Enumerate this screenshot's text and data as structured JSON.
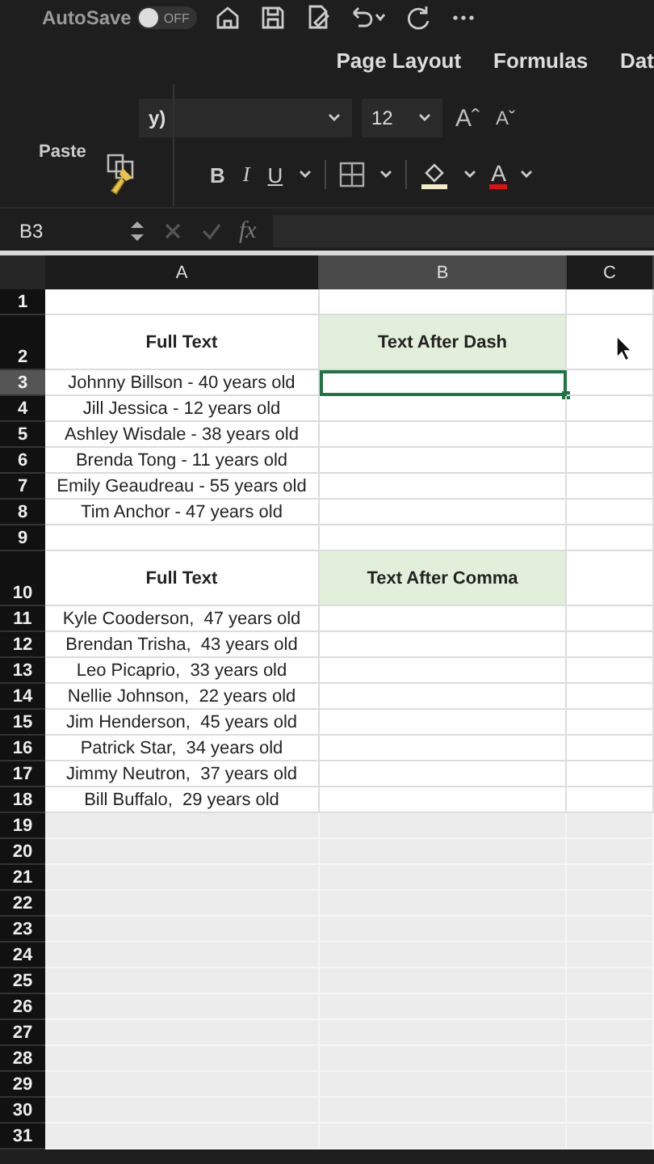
{
  "title_bar": {
    "autosave_label": "AutoSave",
    "autosave_toggle": {
      "on": false,
      "label": "OFF"
    }
  },
  "ribbon_tabs": [
    {
      "label": "Page Layout",
      "selected": false
    },
    {
      "label": "Formulas",
      "selected": false
    },
    {
      "label": "Dat",
      "selected": false
    }
  ],
  "ribbon": {
    "font_name": "y)",
    "font_size": "12",
    "font_size_buttons": [
      "Aˆ",
      "Aˇ"
    ],
    "paste_label": "Paste",
    "format_buttons": [
      "B",
      "I",
      "U"
    ],
    "font_color_button": "A"
  },
  "formula_bar": {
    "name_box": "B3",
    "fx": "fx"
  },
  "sheet": {
    "columns": [
      {
        "label": "A",
        "selected": false
      },
      {
        "label": "B",
        "selected": true
      },
      {
        "label": "C",
        "selected": false
      }
    ],
    "rows": [
      {
        "number": "1",
        "kind": "empty",
        "selected": false
      },
      {
        "number": "2",
        "kind": "header",
        "selected": false,
        "a": "Full Text",
        "b": "Text After Dash"
      },
      {
        "number": "3",
        "kind": "data",
        "selected": true,
        "a": "Johnny Billson - 40 years old"
      },
      {
        "number": "4",
        "kind": "data",
        "selected": false,
        "a": "Jill Jessica - 12 years old"
      },
      {
        "number": "5",
        "kind": "data",
        "selected": false,
        "a": "Ashley Wisdale - 38 years old"
      },
      {
        "number": "6",
        "kind": "data",
        "selected": false,
        "a": "Brenda Tong - 11 years old"
      },
      {
        "number": "7",
        "kind": "data",
        "selected": false,
        "a": "Emily Geaudreau - 55 years old"
      },
      {
        "number": "8",
        "kind": "data",
        "selected": false,
        "a": "Tim Anchor - 47 years old"
      },
      {
        "number": "9",
        "kind": "empty",
        "selected": false
      },
      {
        "number": "10",
        "kind": "header",
        "selected": false,
        "a": "Full Text",
        "b": "Text After Comma"
      },
      {
        "number": "11",
        "kind": "data",
        "selected": false,
        "a": "Kyle Cooderson,  47 years old"
      },
      {
        "number": "12",
        "kind": "data",
        "selected": false,
        "a": "Brendan Trisha,  43 years old"
      },
      {
        "number": "13",
        "kind": "data",
        "selected": false,
        "a": "Leo Picaprio,  33 years old"
      },
      {
        "number": "14",
        "kind": "data",
        "selected": false,
        "a": "Nellie Johnson,  22 years old"
      },
      {
        "number": "15",
        "kind": "data",
        "selected": false,
        "a": "Jim Henderson,  45 years old"
      },
      {
        "number": "16",
        "kind": "data",
        "selected": false,
        "a": "Patrick Star,  34 years old"
      },
      {
        "number": "17",
        "kind": "data",
        "selected": false,
        "a": "Jimmy Neutron,  37 years old"
      },
      {
        "number": "18",
        "kind": "data",
        "selected": false,
        "a": "Bill Buffalo,  29 years old"
      },
      {
        "number": "19",
        "kind": "empty",
        "selected": false
      },
      {
        "number": "20",
        "kind": "empty",
        "selected": false
      },
      {
        "number": "21",
        "kind": "empty",
        "selected": false
      },
      {
        "number": "22",
        "kind": "empty",
        "selected": false
      },
      {
        "number": "23",
        "kind": "empty",
        "selected": false
      },
      {
        "number": "24",
        "kind": "empty",
        "selected": false
      },
      {
        "number": "25",
        "kind": "empty",
        "selected": false
      },
      {
        "number": "26",
        "kind": "empty",
        "selected": false
      },
      {
        "number": "27",
        "kind": "empty",
        "selected": false
      },
      {
        "number": "28",
        "kind": "empty",
        "selected": false
      },
      {
        "number": "29",
        "kind": "empty",
        "selected": false
      },
      {
        "number": "30",
        "kind": "empty",
        "selected": false
      },
      {
        "number": "31",
        "kind": "empty",
        "selected": false
      }
    ]
  }
}
